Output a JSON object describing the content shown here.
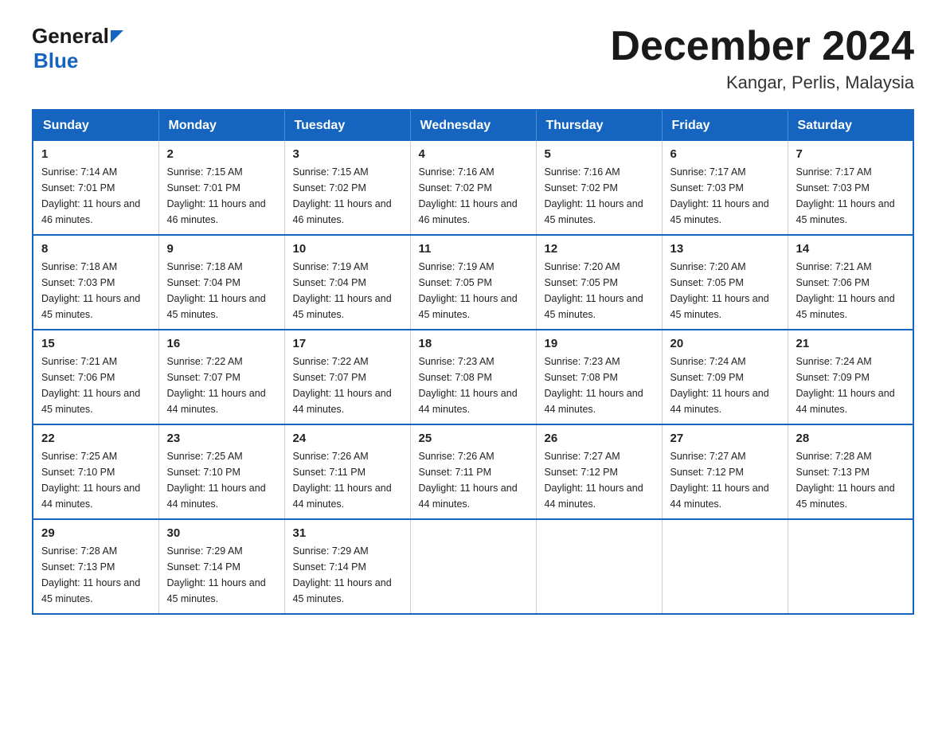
{
  "header": {
    "logo_general": "General",
    "logo_blue": "Blue",
    "month_title": "December 2024",
    "location": "Kangar, Perlis, Malaysia"
  },
  "weekdays": [
    "Sunday",
    "Monday",
    "Tuesday",
    "Wednesday",
    "Thursday",
    "Friday",
    "Saturday"
  ],
  "weeks": [
    [
      {
        "day": "1",
        "sunrise": "Sunrise: 7:14 AM",
        "sunset": "Sunset: 7:01 PM",
        "daylight": "Daylight: 11 hours and 46 minutes."
      },
      {
        "day": "2",
        "sunrise": "Sunrise: 7:15 AM",
        "sunset": "Sunset: 7:01 PM",
        "daylight": "Daylight: 11 hours and 46 minutes."
      },
      {
        "day": "3",
        "sunrise": "Sunrise: 7:15 AM",
        "sunset": "Sunset: 7:02 PM",
        "daylight": "Daylight: 11 hours and 46 minutes."
      },
      {
        "day": "4",
        "sunrise": "Sunrise: 7:16 AM",
        "sunset": "Sunset: 7:02 PM",
        "daylight": "Daylight: 11 hours and 46 minutes."
      },
      {
        "day": "5",
        "sunrise": "Sunrise: 7:16 AM",
        "sunset": "Sunset: 7:02 PM",
        "daylight": "Daylight: 11 hours and 45 minutes."
      },
      {
        "day": "6",
        "sunrise": "Sunrise: 7:17 AM",
        "sunset": "Sunset: 7:03 PM",
        "daylight": "Daylight: 11 hours and 45 minutes."
      },
      {
        "day": "7",
        "sunrise": "Sunrise: 7:17 AM",
        "sunset": "Sunset: 7:03 PM",
        "daylight": "Daylight: 11 hours and 45 minutes."
      }
    ],
    [
      {
        "day": "8",
        "sunrise": "Sunrise: 7:18 AM",
        "sunset": "Sunset: 7:03 PM",
        "daylight": "Daylight: 11 hours and 45 minutes."
      },
      {
        "day": "9",
        "sunrise": "Sunrise: 7:18 AM",
        "sunset": "Sunset: 7:04 PM",
        "daylight": "Daylight: 11 hours and 45 minutes."
      },
      {
        "day": "10",
        "sunrise": "Sunrise: 7:19 AM",
        "sunset": "Sunset: 7:04 PM",
        "daylight": "Daylight: 11 hours and 45 minutes."
      },
      {
        "day": "11",
        "sunrise": "Sunrise: 7:19 AM",
        "sunset": "Sunset: 7:05 PM",
        "daylight": "Daylight: 11 hours and 45 minutes."
      },
      {
        "day": "12",
        "sunrise": "Sunrise: 7:20 AM",
        "sunset": "Sunset: 7:05 PM",
        "daylight": "Daylight: 11 hours and 45 minutes."
      },
      {
        "day": "13",
        "sunrise": "Sunrise: 7:20 AM",
        "sunset": "Sunset: 7:05 PM",
        "daylight": "Daylight: 11 hours and 45 minutes."
      },
      {
        "day": "14",
        "sunrise": "Sunrise: 7:21 AM",
        "sunset": "Sunset: 7:06 PM",
        "daylight": "Daylight: 11 hours and 45 minutes."
      }
    ],
    [
      {
        "day": "15",
        "sunrise": "Sunrise: 7:21 AM",
        "sunset": "Sunset: 7:06 PM",
        "daylight": "Daylight: 11 hours and 45 minutes."
      },
      {
        "day": "16",
        "sunrise": "Sunrise: 7:22 AM",
        "sunset": "Sunset: 7:07 PM",
        "daylight": "Daylight: 11 hours and 44 minutes."
      },
      {
        "day": "17",
        "sunrise": "Sunrise: 7:22 AM",
        "sunset": "Sunset: 7:07 PM",
        "daylight": "Daylight: 11 hours and 44 minutes."
      },
      {
        "day": "18",
        "sunrise": "Sunrise: 7:23 AM",
        "sunset": "Sunset: 7:08 PM",
        "daylight": "Daylight: 11 hours and 44 minutes."
      },
      {
        "day": "19",
        "sunrise": "Sunrise: 7:23 AM",
        "sunset": "Sunset: 7:08 PM",
        "daylight": "Daylight: 11 hours and 44 minutes."
      },
      {
        "day": "20",
        "sunrise": "Sunrise: 7:24 AM",
        "sunset": "Sunset: 7:09 PM",
        "daylight": "Daylight: 11 hours and 44 minutes."
      },
      {
        "day": "21",
        "sunrise": "Sunrise: 7:24 AM",
        "sunset": "Sunset: 7:09 PM",
        "daylight": "Daylight: 11 hours and 44 minutes."
      }
    ],
    [
      {
        "day": "22",
        "sunrise": "Sunrise: 7:25 AM",
        "sunset": "Sunset: 7:10 PM",
        "daylight": "Daylight: 11 hours and 44 minutes."
      },
      {
        "day": "23",
        "sunrise": "Sunrise: 7:25 AM",
        "sunset": "Sunset: 7:10 PM",
        "daylight": "Daylight: 11 hours and 44 minutes."
      },
      {
        "day": "24",
        "sunrise": "Sunrise: 7:26 AM",
        "sunset": "Sunset: 7:11 PM",
        "daylight": "Daylight: 11 hours and 44 minutes."
      },
      {
        "day": "25",
        "sunrise": "Sunrise: 7:26 AM",
        "sunset": "Sunset: 7:11 PM",
        "daylight": "Daylight: 11 hours and 44 minutes."
      },
      {
        "day": "26",
        "sunrise": "Sunrise: 7:27 AM",
        "sunset": "Sunset: 7:12 PM",
        "daylight": "Daylight: 11 hours and 44 minutes."
      },
      {
        "day": "27",
        "sunrise": "Sunrise: 7:27 AM",
        "sunset": "Sunset: 7:12 PM",
        "daylight": "Daylight: 11 hours and 44 minutes."
      },
      {
        "day": "28",
        "sunrise": "Sunrise: 7:28 AM",
        "sunset": "Sunset: 7:13 PM",
        "daylight": "Daylight: 11 hours and 45 minutes."
      }
    ],
    [
      {
        "day": "29",
        "sunrise": "Sunrise: 7:28 AM",
        "sunset": "Sunset: 7:13 PM",
        "daylight": "Daylight: 11 hours and 45 minutes."
      },
      {
        "day": "30",
        "sunrise": "Sunrise: 7:29 AM",
        "sunset": "Sunset: 7:14 PM",
        "daylight": "Daylight: 11 hours and 45 minutes."
      },
      {
        "day": "31",
        "sunrise": "Sunrise: 7:29 AM",
        "sunset": "Sunset: 7:14 PM",
        "daylight": "Daylight: 11 hours and 45 minutes."
      },
      null,
      null,
      null,
      null
    ]
  ]
}
